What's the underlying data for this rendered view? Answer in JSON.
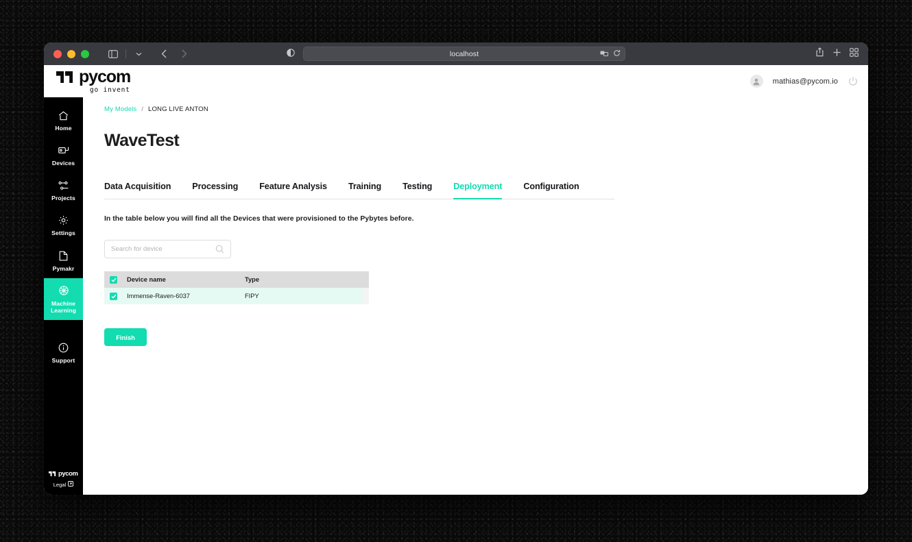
{
  "browser": {
    "url": "localhost",
    "controls": {
      "sidebar_toggle": "sidebar-toggle",
      "tab_group_chevron": "chevron-down",
      "back": "back-arrow",
      "forward": "forward-arrow",
      "reader": "reader-view",
      "extensions": "extensions",
      "reload": "reload",
      "share": "share",
      "new_tab": "plus",
      "tab_overview": "tab-overview"
    }
  },
  "header": {
    "logo_word": "pycom",
    "logo_tagline": "go invent",
    "user_email": "mathias@pycom.io",
    "power_label": "logout"
  },
  "sidebar": {
    "items": [
      {
        "label": "Home",
        "icon": "home-icon",
        "active": false
      },
      {
        "label": "Devices",
        "icon": "device-icon",
        "active": false
      },
      {
        "label": "Projects",
        "icon": "projects-icon",
        "active": false
      },
      {
        "label": "Settings",
        "icon": "gear-icon",
        "active": false
      },
      {
        "label": "Pymakr",
        "icon": "file-code-icon",
        "active": false
      },
      {
        "label": "Machine Learning",
        "icon": "brain-icon",
        "active": true
      },
      {
        "label": "Support",
        "icon": "info-icon",
        "active": false
      }
    ],
    "footer": {
      "logo_word": "pycom",
      "legal_label": "Legal",
      "legal_icon": "external-link-icon"
    }
  },
  "main": {
    "breadcrumb": {
      "root": "My Models",
      "separator": "/",
      "current": "LONG LIVE ANTON"
    },
    "page_title": "WaveTest",
    "tabs": [
      {
        "label": "Data Acquisition",
        "active": false
      },
      {
        "label": "Processing",
        "active": false
      },
      {
        "label": "Feature Analysis",
        "active": false
      },
      {
        "label": "Training",
        "active": false
      },
      {
        "label": "Testing",
        "active": false
      },
      {
        "label": "Deployment",
        "active": true
      },
      {
        "label": "Configuration",
        "active": false
      }
    ],
    "intro_text": "In the table below you will find all the Devices that were provisioned to the Pybytes before.",
    "search": {
      "placeholder": "Search for device",
      "value": "",
      "icon": "search-icon"
    },
    "table": {
      "columns": [
        "Device name",
        "Type"
      ],
      "header_checked": true,
      "rows": [
        {
          "checked": true,
          "device_name": "Immense-Raven-6037",
          "type": "FIPY"
        }
      ]
    },
    "finish_label": "Finish"
  },
  "colors": {
    "accent": "#12dcb0",
    "row_highlight": "#e6faf4",
    "header_gray": "#dcdcdc",
    "sidebar_bg": "#000000",
    "chrome_bg": "#393a3f"
  }
}
